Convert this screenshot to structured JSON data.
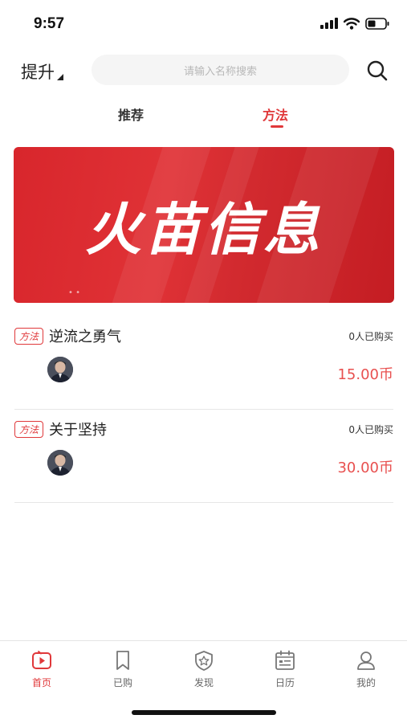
{
  "status_bar": {
    "time": "9:57"
  },
  "header": {
    "title": "提升",
    "search_placeholder": "请输入名称搜索"
  },
  "tabs": [
    {
      "label": "推荐",
      "active": false
    },
    {
      "label": "方法",
      "active": true
    }
  ],
  "banner": {
    "text": "火苗信息"
  },
  "courses": [
    {
      "badge": "方法",
      "title": "逆流之勇气",
      "buyers": "0人已购买",
      "price": "15.00币"
    },
    {
      "badge": "方法",
      "title": "关于坚持",
      "buyers": "0人已购买",
      "price": "30.00币"
    }
  ],
  "tabbar": [
    {
      "label": "首页",
      "icon": "play-icon",
      "active": true
    },
    {
      "label": "已购",
      "icon": "bookmark-icon",
      "active": false
    },
    {
      "label": "发现",
      "icon": "shield-star-icon",
      "active": false
    },
    {
      "label": "日历",
      "icon": "calendar-icon",
      "active": false
    },
    {
      "label": "我的",
      "icon": "user-icon",
      "active": false
    }
  ],
  "colors": {
    "accent": "#e0383a",
    "price": "#e8504f",
    "banner": "#d8262c"
  }
}
